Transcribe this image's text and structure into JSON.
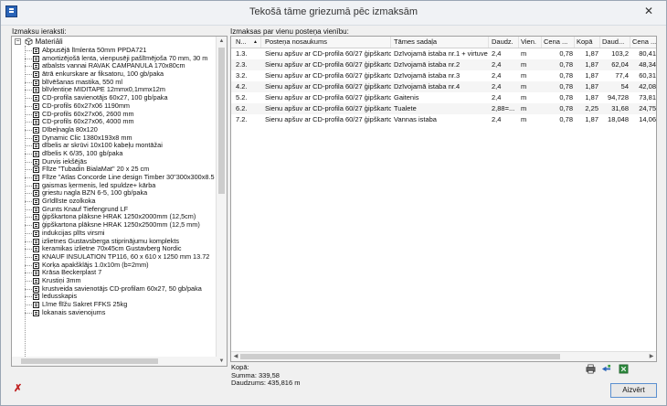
{
  "window": {
    "title": "Tekošā tāme griezumā pēc izmaksām",
    "close_glyph": "✕"
  },
  "left_panel": {
    "label": "Izmaksu ieraksti:",
    "root": "Materiāli",
    "items": [
      "Abpusējā līmlenta 50mm PPDA721",
      "amortizējošā lenta, vienpusēji pašlīmējoša 70 mm, 30 m",
      "atbalsts vannai RAVAK CAMPANULA 170x80cm",
      "ātrā enkurskare ar fiksatoru, 100 gb/paka",
      "blīvēšanas mastika, 550 ml",
      "blīvlentiņe MIDITAPE 12mmx0,1mmx12m",
      "CD-profila savienotājs 60x27, 100 gb/paka",
      "CD-profils 60x27x06 1190mm",
      "CD-profils 60x27x06,  2600 mm",
      "CD-profils 60x27x06, 4000 mm",
      "Dībeļnagla 80x120",
      "Dynamic Clic 1380x193x8 mm",
      "dībelis ar skrūvi 10x100 kabeļu montāžai",
      "dībelis K 6/35, 100 gb/paka",
      "Durvis iekšējās",
      "Flīze \"Tubadin BialaMat\" 20 x 25 cm",
      "Flīze \"Atlas Concorde Line design Timber 30\"300x300x8.5",
      "gaismas ķermenis, led spuldze+ kārba",
      "griestu nagla BZN 6-5, 100 gb/paka",
      "Grīdlīste ozolkoka",
      "Grunts Knauf Tiefengrund LF",
      "ģipškartona plāksne HRAK 1250x2000mm (12,5cm)",
      "ģipškartona plāksne HRAK 1250x2500mm (12,5 mm)",
      "indukcijas plīts virsmi",
      "izlietnes Gustavsberga stiprinājumu komplekts",
      "keramikas izlietne 70x45cm Gustavberg Nordic",
      "KNAUF INSULATION TP116,   60 x 610 x 1250 mm  13.72",
      "Korķa apakšklājs 1.0x10m (b=2mm)",
      "Krāsa Beckerplast 7",
      "Krustiņi 3mm",
      "krustveida savienotājs CD-profilam 60x27, 50 gb/paka",
      "ledusskapis",
      "Līme flīžu Sakret FFKS 25kg",
      "lokanais savienojums"
    ]
  },
  "right_panel": {
    "label": "Izmaksas par vienu posteņa vienību:",
    "columns": [
      "N...",
      "Posteņa nosaukums",
      "Tāmes sadaļa",
      "Daudz.",
      "Vien.",
      "Cena ...",
      "Kopā",
      "Daud...",
      "Cena ..."
    ],
    "sort_indicator": "▲",
    "rows": [
      [
        "1.3.",
        "Sienu apšuv ar CD-profila 60/27 ģipškarto...",
        "Dzīvojamā istaba nr.1 + virtuve",
        "2,4",
        "m",
        "0,78",
        "1,87",
        "103,2",
        "80,41"
      ],
      [
        "2.3.",
        "Sienu apšuv ar CD-profila 60/27 ģipškarto...",
        "Dzīvojamā istaba nr.2",
        "2,4",
        "m",
        "0,78",
        "1,87",
        "62,04",
        "48,34"
      ],
      [
        "3.2.",
        "Sienu apšuv ar CD-profila 60/27 ģipškarto...",
        "Dzīvojamā istaba nr.3",
        "2,4",
        "m",
        "0,78",
        "1,87",
        "77,4",
        "60,31"
      ],
      [
        "4.2.",
        "Sienu apšuv ar CD-profila 60/27 ģipškarto...",
        "Dzīvojamā istaba nr.4",
        "2,4",
        "m",
        "0,78",
        "1,87",
        "54",
        "42,08"
      ],
      [
        "5.2.",
        "Sienu apšuv ar CD-profila 60/27 ģipškarto...",
        "Gaitenis",
        "2,4",
        "m",
        "0,78",
        "1,87",
        "94,728",
        "73,81"
      ],
      [
        "6.2.",
        "Sienu apšuv ar CD-profila 60/27 ģipškarto...",
        "Tualete",
        "2,88=...",
        "m",
        "0,78",
        "2,25",
        "31,68",
        "24,75"
      ],
      [
        "7.2.",
        "Sienu apšuv ar CD-profila 60/27 ģipškarto...",
        "Vannas istaba",
        "2,4",
        "m",
        "0,78",
        "1,87",
        "18,048",
        "14,06"
      ]
    ]
  },
  "summary": {
    "heading": "Kopā:",
    "sum": "Summa: 339,58",
    "quantity": "Daudzums: 435,816 m"
  },
  "buttons": {
    "close": "Aizvērt"
  },
  "colors": {
    "accent": "#2a64b8",
    "focus_border": "#5a8fd0"
  }
}
